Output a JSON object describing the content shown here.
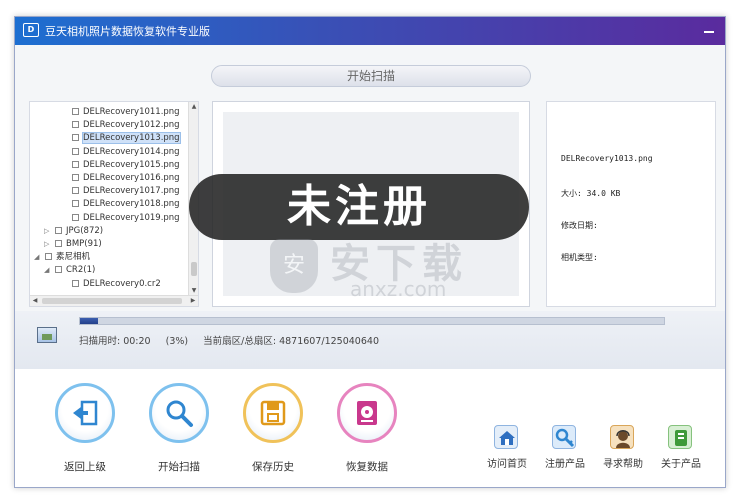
{
  "window": {
    "title": "豆天相机照片数据恢复软件专业版",
    "logo_text": "D",
    "minimize_icon": "minimize-icon"
  },
  "scan_header": "开始扫描",
  "tree": {
    "rows": [
      {
        "label": "DELRecovery1011.png",
        "type": "file"
      },
      {
        "label": "DELRecovery1012.png",
        "type": "file"
      },
      {
        "label": "DELRecovery1013.png",
        "type": "file",
        "selected": true
      },
      {
        "label": "DELRecovery1014.png",
        "type": "file"
      },
      {
        "label": "DELRecovery1015.png",
        "type": "file"
      },
      {
        "label": "DELRecovery1016.png",
        "type": "file"
      },
      {
        "label": "DELRecovery1017.png",
        "type": "file"
      },
      {
        "label": "DELRecovery1018.png",
        "type": "file"
      },
      {
        "label": "DELRecovery1019.png",
        "type": "file"
      },
      {
        "label": "JPG(872)",
        "type": "folder",
        "toggle": "▷"
      },
      {
        "label": "BMP(91)",
        "type": "folder",
        "toggle": "▷"
      },
      {
        "label": "素尼相机",
        "type": "folder",
        "toggle": "◢"
      },
      {
        "label": "CR2(1)",
        "type": "folder",
        "toggle": "◢"
      },
      {
        "label": "DELRecovery0.cr2",
        "type": "file"
      }
    ]
  },
  "info": {
    "filename": "DELRecovery1013.png",
    "size_label": "大小: 34.0 KB",
    "modified_label": "修改日期:",
    "camera_label": "相机类型:"
  },
  "watermark": {
    "text": "未注册",
    "site_cn": "安下载",
    "site_en": "anxz.com",
    "shield_glyph": "安"
  },
  "progress": {
    "percent": 3,
    "elapsed": "扫描用时: 00:20",
    "percent_text": "(3%)",
    "sector": "当前扇区/总扇区: 4871607/125040640"
  },
  "big_buttons": [
    {
      "label": "返回上级",
      "icon": "back-icon",
      "color": "#4aa3e0"
    },
    {
      "label": "开始扫描",
      "icon": "magnifier-icon",
      "color": "#4aa3e0"
    },
    {
      "label": "保存历史",
      "icon": "save-icon",
      "color": "#e8a82a"
    },
    {
      "label": "恢复数据",
      "icon": "disk-icon",
      "color": "#d34f9e"
    }
  ],
  "small_buttons": [
    {
      "label": "访问首页",
      "icon": "home-icon",
      "color": "#3a7fd0"
    },
    {
      "label": "注册产品",
      "icon": "key-icon",
      "color": "#3a7fd0"
    },
    {
      "label": "寻求帮助",
      "icon": "support-icon",
      "color": "#e6a13a"
    },
    {
      "label": "关于产品",
      "icon": "about-icon",
      "color": "#4fa84a"
    }
  ]
}
